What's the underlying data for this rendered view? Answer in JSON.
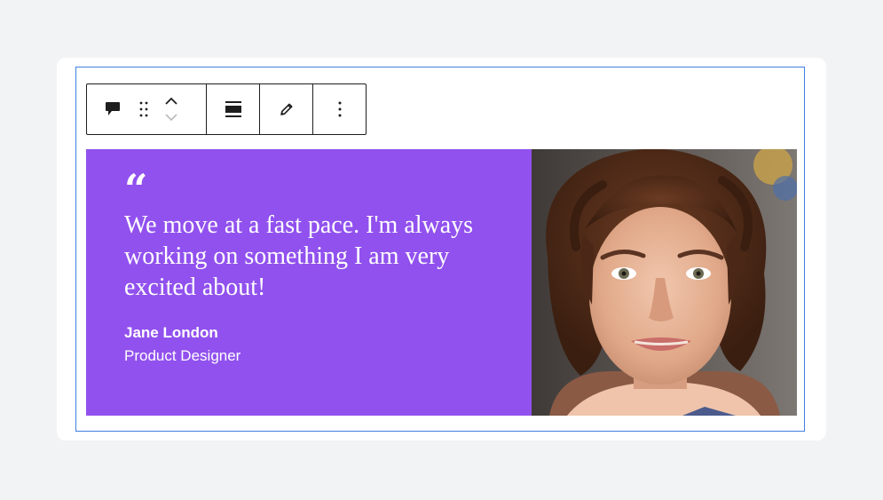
{
  "toolbar": {
    "buttons": [
      {
        "name": "block-type-quote",
        "icon": "speech-bubble-icon"
      },
      {
        "name": "drag-handle",
        "icon": "drag-dots-icon"
      },
      {
        "name": "move-up",
        "icon": "chevron-up-icon"
      },
      {
        "name": "move-down",
        "icon": "chevron-down-icon"
      },
      {
        "name": "align",
        "icon": "align-full-icon"
      },
      {
        "name": "edit",
        "icon": "pencil-icon"
      },
      {
        "name": "options",
        "icon": "more-vertical-icon"
      }
    ]
  },
  "testimonial": {
    "quote_mark": "“",
    "quote": "We move at a fast pace. I'm always working on something I am very excited about!",
    "author_name": "Jane London",
    "author_role": "Product Designer",
    "background_color": "#9151ee",
    "photo": "portrait of a smiling woman with curly brown hair"
  },
  "colors": {
    "selection_border": "#3f7fe0",
    "page_background": "#f2f3f5"
  }
}
